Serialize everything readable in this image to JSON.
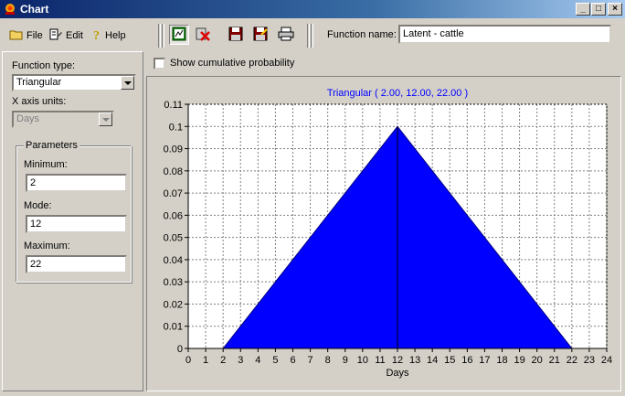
{
  "window": {
    "title": "Chart"
  },
  "menu": {
    "file": "File",
    "edit": "Edit",
    "help": "Help"
  },
  "toolbar": {
    "function_name_label": "Function name:",
    "function_name_value": "Latent - cattle"
  },
  "left_panel": {
    "function_type_label": "Function type:",
    "function_type_value": "Triangular",
    "x_axis_units_label": "X axis units:",
    "x_axis_units_value": "Days",
    "parameters": {
      "legend": "Parameters",
      "minimum_label": "Minimum:",
      "minimum_value": "2",
      "mode_label": "Mode:",
      "mode_value": "12",
      "maximum_label": "Maximum:",
      "maximum_value": "22"
    }
  },
  "options": {
    "show_cumulative_label": "Show cumulative probability",
    "show_cumulative_checked": false
  },
  "chart_data": {
    "type": "area",
    "title": "Triangular ( 2.00, 12.00, 22.00 )",
    "xlabel": "Days",
    "ylabel": "",
    "x": [
      2,
      12,
      22
    ],
    "y": [
      0,
      0.1,
      0
    ],
    "mode_marker_x": 12,
    "xlim": [
      0,
      24
    ],
    "ylim": [
      0,
      0.11
    ],
    "x_ticks": [
      "0",
      "1",
      "2",
      "3",
      "4",
      "5",
      "6",
      "7",
      "8",
      "9",
      "10",
      "11",
      "12",
      "13",
      "14",
      "15",
      "16",
      "17",
      "18",
      "19",
      "20",
      "21",
      "22",
      "23",
      "24"
    ],
    "y_ticks": [
      "0",
      "0.01",
      "0.02",
      "0.03",
      "0.04",
      "0.05",
      "0.06",
      "0.07",
      "0.08",
      "0.09",
      "0.1",
      "0.11"
    ],
    "grid": true,
    "fill_color": "#0000ff",
    "title_color": "#0000ff"
  }
}
